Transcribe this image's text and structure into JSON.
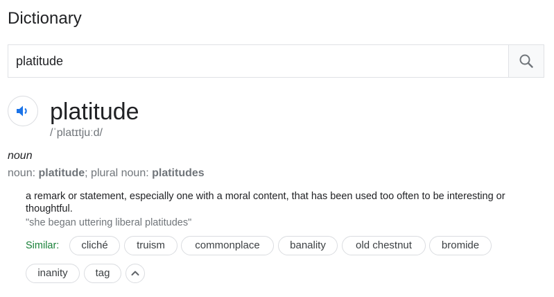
{
  "section_title": "Dictionary",
  "search": {
    "value": "platitude",
    "icon": "search-icon"
  },
  "entry": {
    "word": "platitude",
    "phonetic": "/ˈplatɪtjuːd/",
    "part_of_speech": "noun",
    "inflection_prefix": "noun: ",
    "inflection_singular": "platitude",
    "inflection_sep": "; plural noun: ",
    "inflection_plural": "platitudes",
    "definition": "a remark or statement, especially one with a moral content, that has been used too often to be interesting or thoughtful.",
    "example": "\"she began uttering liberal platitudes\"",
    "similar_label": "Similar:",
    "similar": [
      "cliché",
      "truism",
      "commonplace",
      "banality",
      "old chestnut",
      "bromide",
      "inanity",
      "tag"
    ]
  },
  "colors": {
    "accent_blue": "#1a73e8",
    "similar_green": "#188038",
    "border": "#dadce0",
    "muted_text": "#70757a"
  }
}
